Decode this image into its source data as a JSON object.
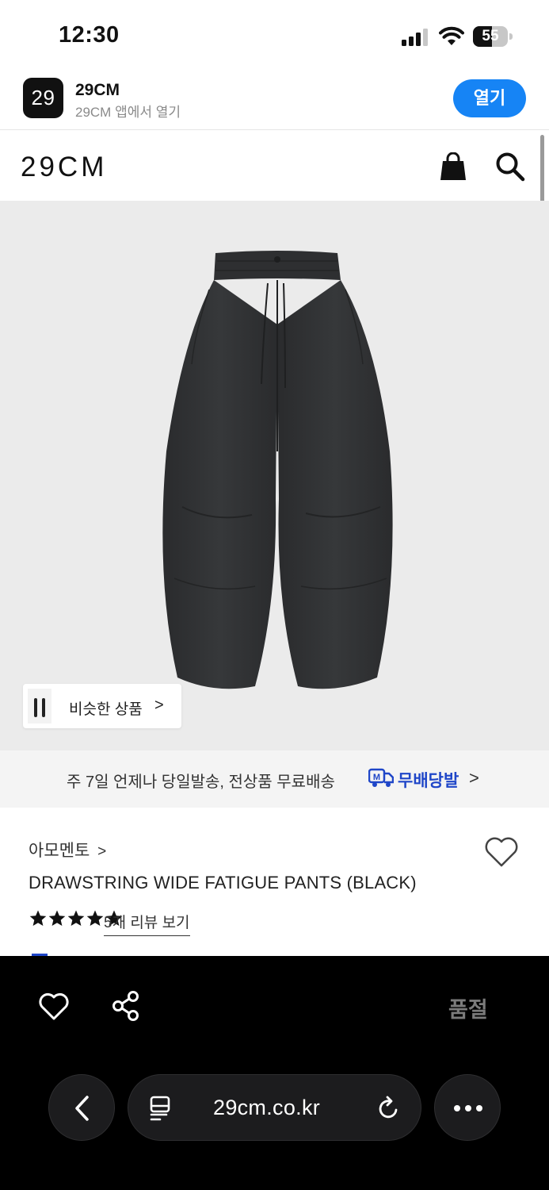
{
  "status_bar": {
    "time": "12:30",
    "battery": "55",
    "battery_level": 0.55
  },
  "app_banner": {
    "icon_text": "29",
    "name": "29CM",
    "subtitle": "29CM 앱에서 열기",
    "open_label": "열기"
  },
  "header": {
    "logo": "29CM"
  },
  "product_image": {
    "similar_label": "비슷한 상품",
    "similar_chevron": ">"
  },
  "shipping": {
    "text": "주 7일 언제나 당일발송, 전상품 무료배송",
    "badge": "M",
    "brand": "무배당발",
    "chevron": ">"
  },
  "product": {
    "brand": "아모멘토",
    "brand_chevron": ">",
    "title": "DRAWSTRING WIDE FATIGUE PANTS (BLACK)",
    "rating": 5,
    "review_label": "5개 리뷰 보기"
  },
  "bottom": {
    "sold_out_label": "품절"
  },
  "browser": {
    "url": "29cm.co.kr"
  },
  "colors": {
    "accent": "#1684f5",
    "shipping_brand": "#1f46c8",
    "sold_out": "#7b7b7b"
  }
}
